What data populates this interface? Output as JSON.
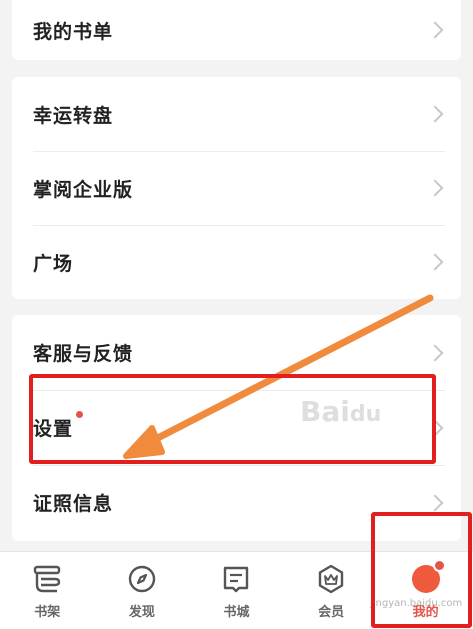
{
  "menu": {
    "group1": [
      {
        "label": "我的书单"
      }
    ],
    "group2": [
      {
        "label": "幸运转盘"
      },
      {
        "label": "掌阅企业版"
      },
      {
        "label": "广场"
      }
    ],
    "group3": [
      {
        "label": "客服与反馈"
      },
      {
        "label": "设置",
        "has_dot": true
      },
      {
        "label": "证照信息"
      }
    ]
  },
  "tabbar": {
    "items": [
      {
        "label": "书架",
        "icon": "bookshelf-icon"
      },
      {
        "label": "发现",
        "icon": "compass-icon"
      },
      {
        "label": "书城",
        "icon": "bookstore-icon"
      },
      {
        "label": "会员",
        "icon": "vip-icon"
      },
      {
        "label": "我的",
        "icon": "me-icon",
        "active": true
      }
    ]
  },
  "colors": {
    "accent": "#e5544b",
    "annotation": "#e21e1e",
    "arrow": "#f08a3c"
  },
  "watermark": {
    "brand": "Baidu经验",
    "url": "jingyan.baidu.com"
  }
}
